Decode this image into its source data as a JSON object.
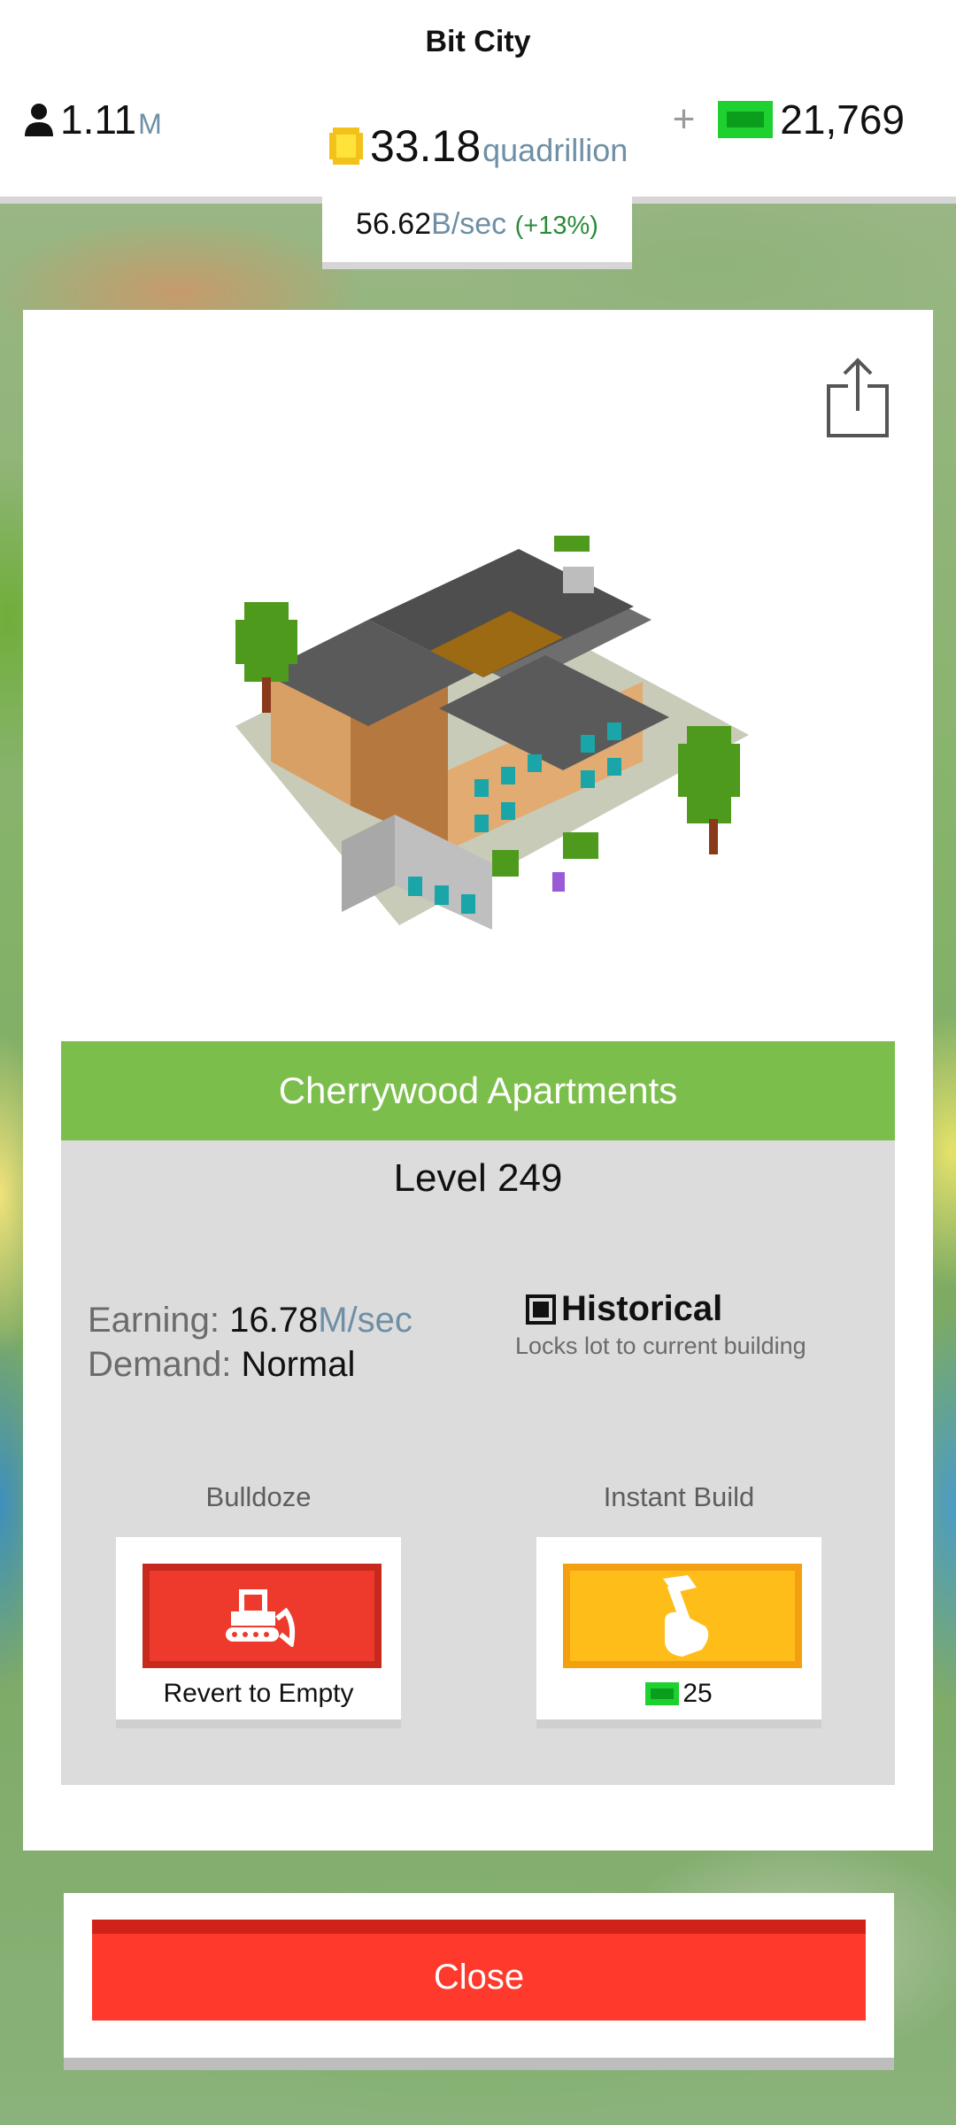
{
  "header": {
    "app_title": "Bit City",
    "population": {
      "value": "1.11",
      "unit": "M",
      "icon": "person-icon"
    },
    "coins": {
      "value": "33.18",
      "unit": "quadrillion",
      "icon": "coin-icon"
    },
    "cash": {
      "plus": "+",
      "value": "21,769",
      "icon": "cash-bill-icon"
    },
    "income_rate": {
      "value": "56.62",
      "unit": "B/sec",
      "boost": "(+13%)"
    }
  },
  "building_card": {
    "share_icon": "share-icon",
    "name": "Cherrywood Apartments",
    "level": "Level 249",
    "earning": {
      "label": "Earning:",
      "value": "16.78",
      "unit": "M/sec"
    },
    "demand": {
      "label": "Demand:",
      "value": "Normal"
    },
    "historical": {
      "title": "Historical",
      "subtitle": "Locks lot to current building",
      "checked": true
    },
    "bulldoze": {
      "label": "Bulldoze",
      "caption": "Revert to Empty",
      "icon": "bulldozer-icon"
    },
    "instant_build": {
      "label": "Instant Build",
      "cost": "25",
      "icon": "hammer-icon"
    }
  },
  "close_label": "Close",
  "colors": {
    "header_green": "#7cbe4b",
    "bulldoze_red": "#ee3a2c",
    "instant_yellow": "#ffbd1a",
    "close_red": "#ff3a2c",
    "unit_blue": "#6e8fa5",
    "boost_green": "#2a8b3a"
  }
}
